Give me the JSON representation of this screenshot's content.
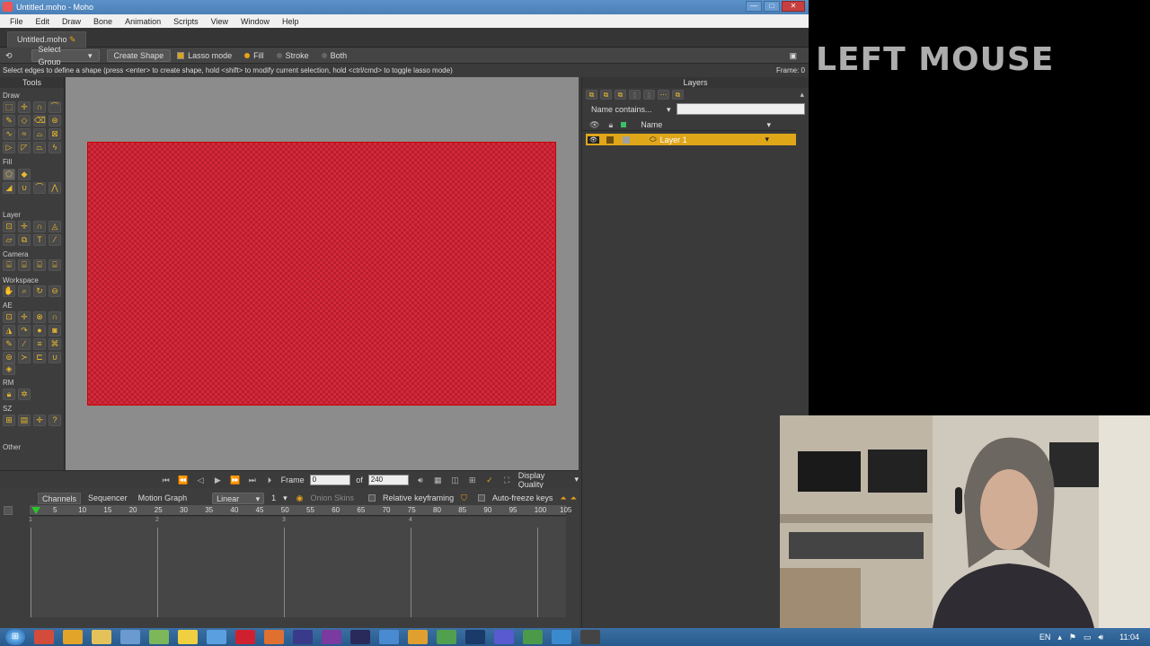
{
  "window": {
    "title": "Untitled.moho - Moho",
    "min": "—",
    "max": "□",
    "close": "✕"
  },
  "menu": [
    "File",
    "Edit",
    "Draw",
    "Bone",
    "Animation",
    "Scripts",
    "View",
    "Window",
    "Help"
  ],
  "doc_tab": "Untitled.moho",
  "tool_options": {
    "select_group": "Select Group",
    "create_shape": "Create Shape",
    "lasso_mode": "Lasso mode",
    "fill": "Fill",
    "stroke": "Stroke",
    "both": "Both"
  },
  "status": {
    "message": "Select edges to define a shape (press <enter> to create shape, hold <shift> to modify current selection, hold <ctrl/cmd> to toggle lasso mode)",
    "frame": "Frame: 0"
  },
  "tools": {
    "header": "Tools",
    "sections": [
      "Draw",
      "Fill",
      "Layer",
      "Camera",
      "Workspace",
      "AE",
      "RM",
      "SZ",
      "Other"
    ]
  },
  "transport": {
    "frame_label": "Frame",
    "frame_value": "0",
    "of_label": "of",
    "total_frames": "240",
    "display_quality": "Display Quality"
  },
  "timeline": {
    "tabs": [
      "Channels",
      "Sequencer",
      "Motion Graph"
    ],
    "interp": "Linear",
    "interp_count": "1",
    "onion_skins": "Onion Skins",
    "relative_keyframing": "Relative keyframing",
    "auto_freeze": "Auto-freeze keys",
    "ticks": [
      "5",
      "10",
      "15",
      "20",
      "25",
      "30",
      "35",
      "40",
      "45",
      "50",
      "55",
      "60",
      "65",
      "70",
      "75",
      "80",
      "85",
      "90",
      "95",
      "100",
      "105"
    ],
    "key_markers": [
      "1",
      "2",
      "3",
      "4"
    ]
  },
  "layers_panel": {
    "header": "Layers",
    "filter_label": "Name contains...",
    "name_col": "Name",
    "layer_name": "Layer 1"
  },
  "overlay": {
    "left_mouse": "LEFT MOUSE"
  },
  "taskbar": {
    "lang": "EN",
    "time": "11:04"
  }
}
